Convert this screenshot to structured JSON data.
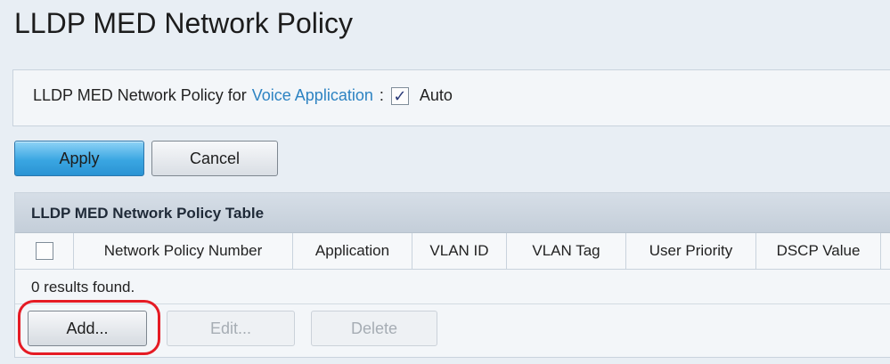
{
  "page": {
    "title": "LLDP MED Network Policy"
  },
  "voice": {
    "label": "LLDP MED Network Policy for",
    "link": "Voice Application",
    "colon": ":",
    "checkbox_checked": true,
    "checkbox_glyph": "✓",
    "auto_label": "Auto"
  },
  "actions": {
    "apply_label": "Apply",
    "cancel_label": "Cancel"
  },
  "table": {
    "caption": "LLDP MED Network Policy Table",
    "columns": [
      "Network Policy Number",
      "Application",
      "VLAN ID",
      "VLAN Tag",
      "User Priority",
      "DSCP Value"
    ],
    "results_text": "0 results found.",
    "add_label": "Add...",
    "edit_label": "Edit...",
    "delete_label": "Delete"
  },
  "colors": {
    "link": "#2d83c2",
    "apply_blue": "#3aa6e2",
    "highlight_red": "#e51b24"
  }
}
